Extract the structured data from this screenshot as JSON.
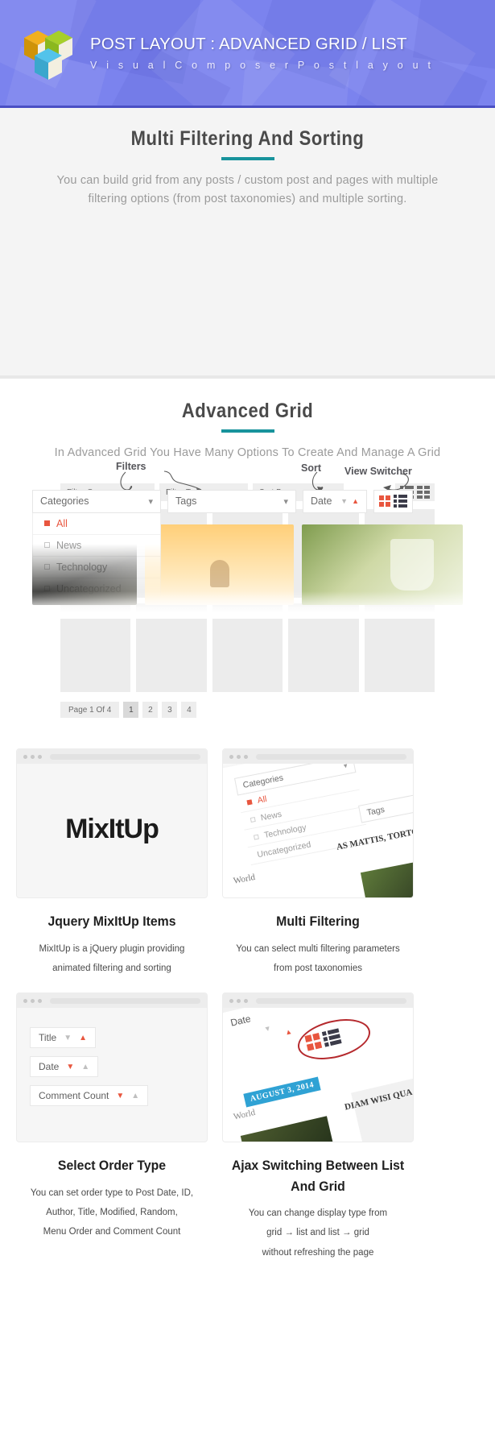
{
  "header": {
    "title": "POST LAYOUT : ADVANCED GRID / LIST",
    "subtitle": "V i s u a l   C o m p o s e r   P o s t   l a y o u t",
    "logo_icon": "isometric-cubes-logo",
    "bg_color": "#7b83ee"
  },
  "section_filtering": {
    "title": "Multi Filtering And Sorting",
    "description": "You can build grid from any posts / custom post and pages with multiple filtering options (from post taxonomies) and multiple sorting.",
    "annotations": {
      "filters": "Filters",
      "sort": "Sort",
      "view_switcher": "View Switcher"
    },
    "toolbar": {
      "categories_label": "Categories",
      "tags_label": "Tags",
      "date_label": "Date",
      "chevron_icon": "chevron-down-icon",
      "sort_desc_icon": "triangle-down-icon",
      "sort_asc_icon": "triangle-up-icon",
      "grid_view_icon": "grid-view-icon",
      "list_view_icon": "list-view-icon"
    },
    "dropdown_items": [
      {
        "label": "All",
        "active": true
      },
      {
        "label": "News",
        "active": false
      },
      {
        "label": "Technology",
        "active": false
      },
      {
        "label": "Uncategorized",
        "active": false
      }
    ]
  },
  "section_advanced_grid": {
    "title": "Advanced Grid",
    "description": "In Advanced Grid You Have Many Options To Create And Manage A Grid",
    "toolbar": {
      "filter_one": "Filter One",
      "filter_two": "Filter Two",
      "sort_by": "Sort By",
      "chevron_icon": "chevron-down-icon",
      "sort_up_icon": "chevron-up-icon",
      "sort_down_icon": "chevron-down-icon",
      "list_view_icon": "list-view-icon",
      "grid_view_icon": "grid-view-icon"
    },
    "grid_rows": 2,
    "grid_cols": 5,
    "pagination": {
      "label": "Page 1 Of 4",
      "pages": [
        "1",
        "2",
        "3",
        "4"
      ],
      "current": "1"
    }
  },
  "features": [
    {
      "id": "jquery-mixitup-items",
      "title": "Jquery MixItUp Items",
      "lines": [
        "MixItUp is a jQuery plugin providing",
        "animated filtering and sorting"
      ],
      "preview": {
        "type": "mixitup-logo",
        "logo_text": "MixItUp"
      }
    },
    {
      "id": "multi-filtering",
      "title": "Multi Filtering",
      "lines": [
        "You can select multi filtering parameters",
        "from post taxonomies"
      ],
      "preview": {
        "type": "tilted-filter-panel",
        "categories_label": "Categories",
        "tags_label": "Tags",
        "items": [
          "All",
          "News",
          "Technology",
          "Uncategorized"
        ],
        "caption_text": "AS MATTIS, TORTOR",
        "world_tag": "World"
      }
    },
    {
      "id": "select-order-type",
      "title": "Select Order Type",
      "lines": [
        "You can set order type to Post Date, ID,",
        "Author, Title, Modified, Random,",
        "Menu Order and Comment Count"
      ],
      "preview": {
        "type": "order-selects",
        "selects": [
          {
            "label": "Title",
            "down_active": false,
            "up_active": true
          },
          {
            "label": "Date",
            "down_active": true,
            "up_active": false
          },
          {
            "label": "Comment Count",
            "down_active": true,
            "up_active": false
          }
        ]
      }
    },
    {
      "id": "ajax-switching-between-list-and-grid",
      "title": "Ajax Switching Between List And Grid",
      "lines": [
        "You can change display type from",
        "grid → list   and   list → grid",
        "without refreshing the page"
      ],
      "preview": {
        "type": "tilted-view-switcher",
        "date_label": "Date",
        "badge_text": "AUGUST 3, 2014",
        "world_tag": "World",
        "caption_text": "DIAM WISI QUA",
        "highlight_color": "#b5292d"
      }
    }
  ],
  "colors": {
    "accent_teal": "#18939c",
    "accent_orange": "#e8563f",
    "header_purple": "#7b83ee",
    "badge_blue": "#2fa2d4"
  }
}
